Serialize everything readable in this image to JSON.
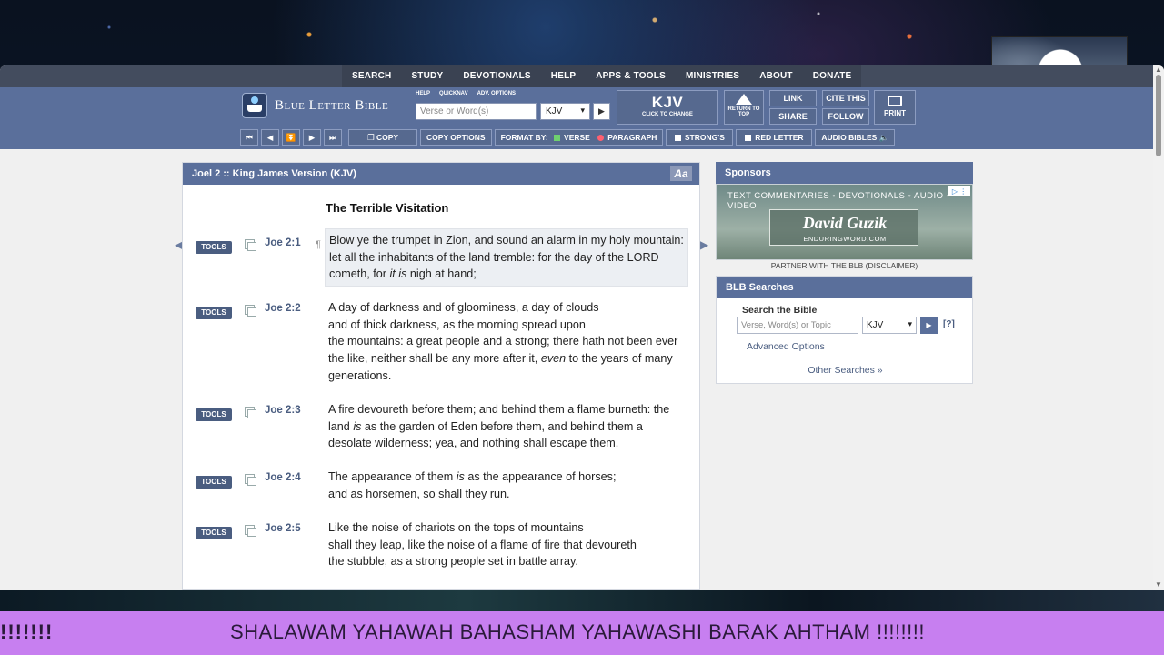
{
  "topnav": [
    "SEARCH",
    "STUDY",
    "DEVOTIONALS",
    "HELP",
    "APPS & TOOLS",
    "MINISTRIES",
    "ABOUT",
    "DONATE"
  ],
  "header": {
    "logo_text": "Blue Letter Bible",
    "mini_links": [
      "HELP",
      "QUICKNAV",
      "ADV. OPTIONS"
    ],
    "search_placeholder": "Verse or Word(s)",
    "version": "KJV",
    "kjv_big": "KJV",
    "kjv_small": "CLICK TO CHANGE",
    "return_top": "RETURN TO TOP",
    "link": "LINK",
    "share": "SHARE",
    "cite": "CITE THIS",
    "follow": "FOLLOW",
    "print": "PRINT"
  },
  "toolbar": {
    "nav_buttons": [
      "⏮",
      "◀",
      "⏬",
      "▶",
      "⏭"
    ],
    "copy": "COPY",
    "copy_options": "COPY OPTIONS",
    "format_by": "FORMAT BY:",
    "verse": "VERSE",
    "paragraph": "PARAGRAPH",
    "strongs": "STRONG'S",
    "red_letter": "RED LETTER",
    "audio": "AUDIO BIBLES"
  },
  "content": {
    "title": "Joel 2 :: King James Version (KJV)",
    "font_toggle": "Aa",
    "heading": "The Terrible Visitation",
    "tools_label": "TOOLS",
    "verses": [
      {
        "ref": "Joe 2:1",
        "html": "Blow ye the trumpet in Zion, and sound an alarm in my holy mountain: let all the inhabitants of the land tremble: for the day of the LORD cometh, for <i>it is</i> nigh at hand;"
      },
      {
        "ref": "Joe 2:2",
        "html": "A day of darkness and of gloominess, a day of clouds<br>and of thick darkness, as the morning spread upon<br>the mountains: a great people and a strong; there hath not been ever the like, neither shall be any more after it, <i>even</i> to the years of many generations."
      },
      {
        "ref": "Joe 2:3",
        "html": "A fire devoureth before them; and behind them a flame burneth: the land <i>is</i> as the garden of Eden before them, and behind them a desolate wilderness; yea, and nothing shall escape them."
      },
      {
        "ref": "Joe 2:4",
        "html": "The appearance of them <i>is</i> as the appearance of horses;<br>and as horsemen, so shall they run."
      },
      {
        "ref": "Joe 2:5",
        "html": "Like the noise of chariots on the tops of mountains<br>shall they leap, like the noise of a flame of fire that devoureth<br>the stubble, as a strong people set in battle array."
      }
    ]
  },
  "sponsors": {
    "title": "Sponsors",
    "ad_top": "TEXT COMMENTARIES ◦ DEVOTIONALS ◦ AUDIO ◦ VIDEO",
    "ad_name": "David Guzik",
    "ad_sub": "ENDURINGWORD.COM",
    "partner": "PARTNER WITH THE BLB   (DISCLAIMER)"
  },
  "searches": {
    "title": "BLB Searches",
    "search_title": "Search the Bible",
    "placeholder": "Verse, Word(s) or Topic",
    "version": "KJV",
    "help": "[?]",
    "advanced": "Advanced Options",
    "other": "Other Searches »"
  },
  "banner": {
    "left": "!!!!!!!",
    "text": "SHALAWAM YAHAWAH BAHASHAM YAHAWASHI BARAK AHTHAM !!!!!!!!"
  }
}
